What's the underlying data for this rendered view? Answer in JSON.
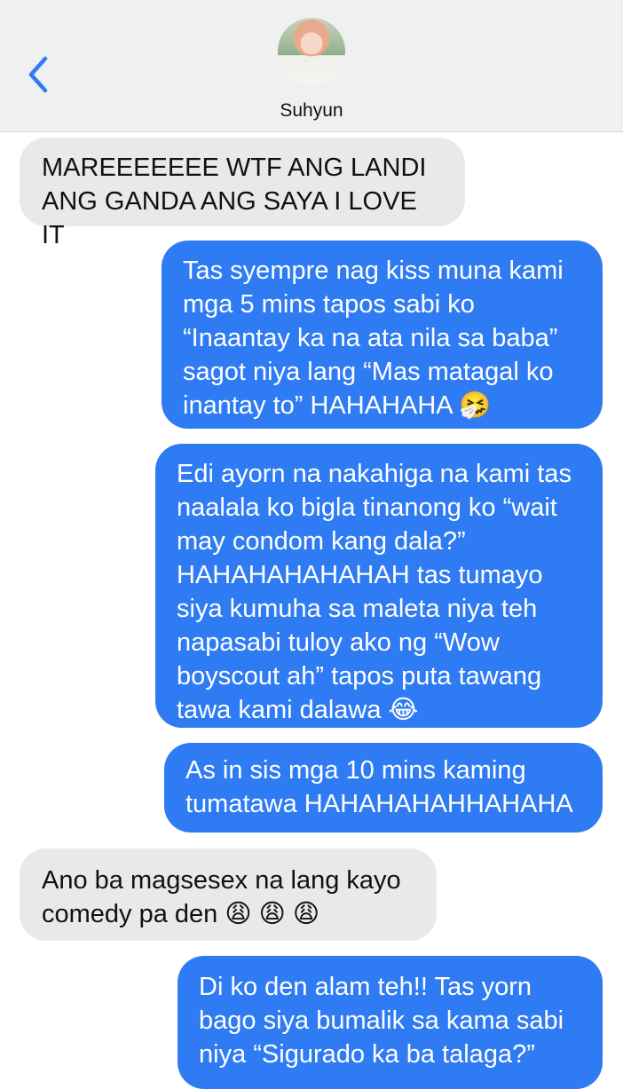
{
  "header": {
    "back_icon": "chevron-left-icon",
    "contact_name": "Suhyun",
    "accent_color": "#2f7bf3"
  },
  "messages": [
    {
      "direction": "incoming",
      "text": "MAREEEEEEE WTF ANG LANDI\nANG GANDA ANG SAYA I LOVE IT"
    },
    {
      "direction": "outgoing",
      "text": "Tas syempre nag kiss muna kami\nmga 5 mins tapos sabi ko\n“Inaantay ka na ata nila sa baba”\nsagot niya lang “Mas matagal ko\ninantay to” HAHAHAHA 🤧"
    },
    {
      "direction": "outgoing",
      "text": "Edi ayorn na nakahiga na kami tas\nnaalala ko bigla tinanong ko “wait\nmay condom kang dala?”\nHAHAHAHAHAHAH tas tumayo\nsiya kumuha sa maleta niya teh\nnapasabi tuloy ako ng “Wow\nboyscout ah” tapos puta tawang\ntawa kami dalawa 😂"
    },
    {
      "direction": "outgoing",
      "text": "As in sis mga 10 mins kaming\ntumatawa HAHAHAHAHHAHAHA"
    },
    {
      "direction": "incoming",
      "text": "Ano ba magsesex na lang kayo\ncomedy pa den 😩 😩 😩"
    },
    {
      "direction": "outgoing",
      "text": "Di ko den alam teh!! Tas yorn\nbago siya bumalik sa kama sabi\nniya “Sigurado ka ba talaga?”"
    }
  ]
}
